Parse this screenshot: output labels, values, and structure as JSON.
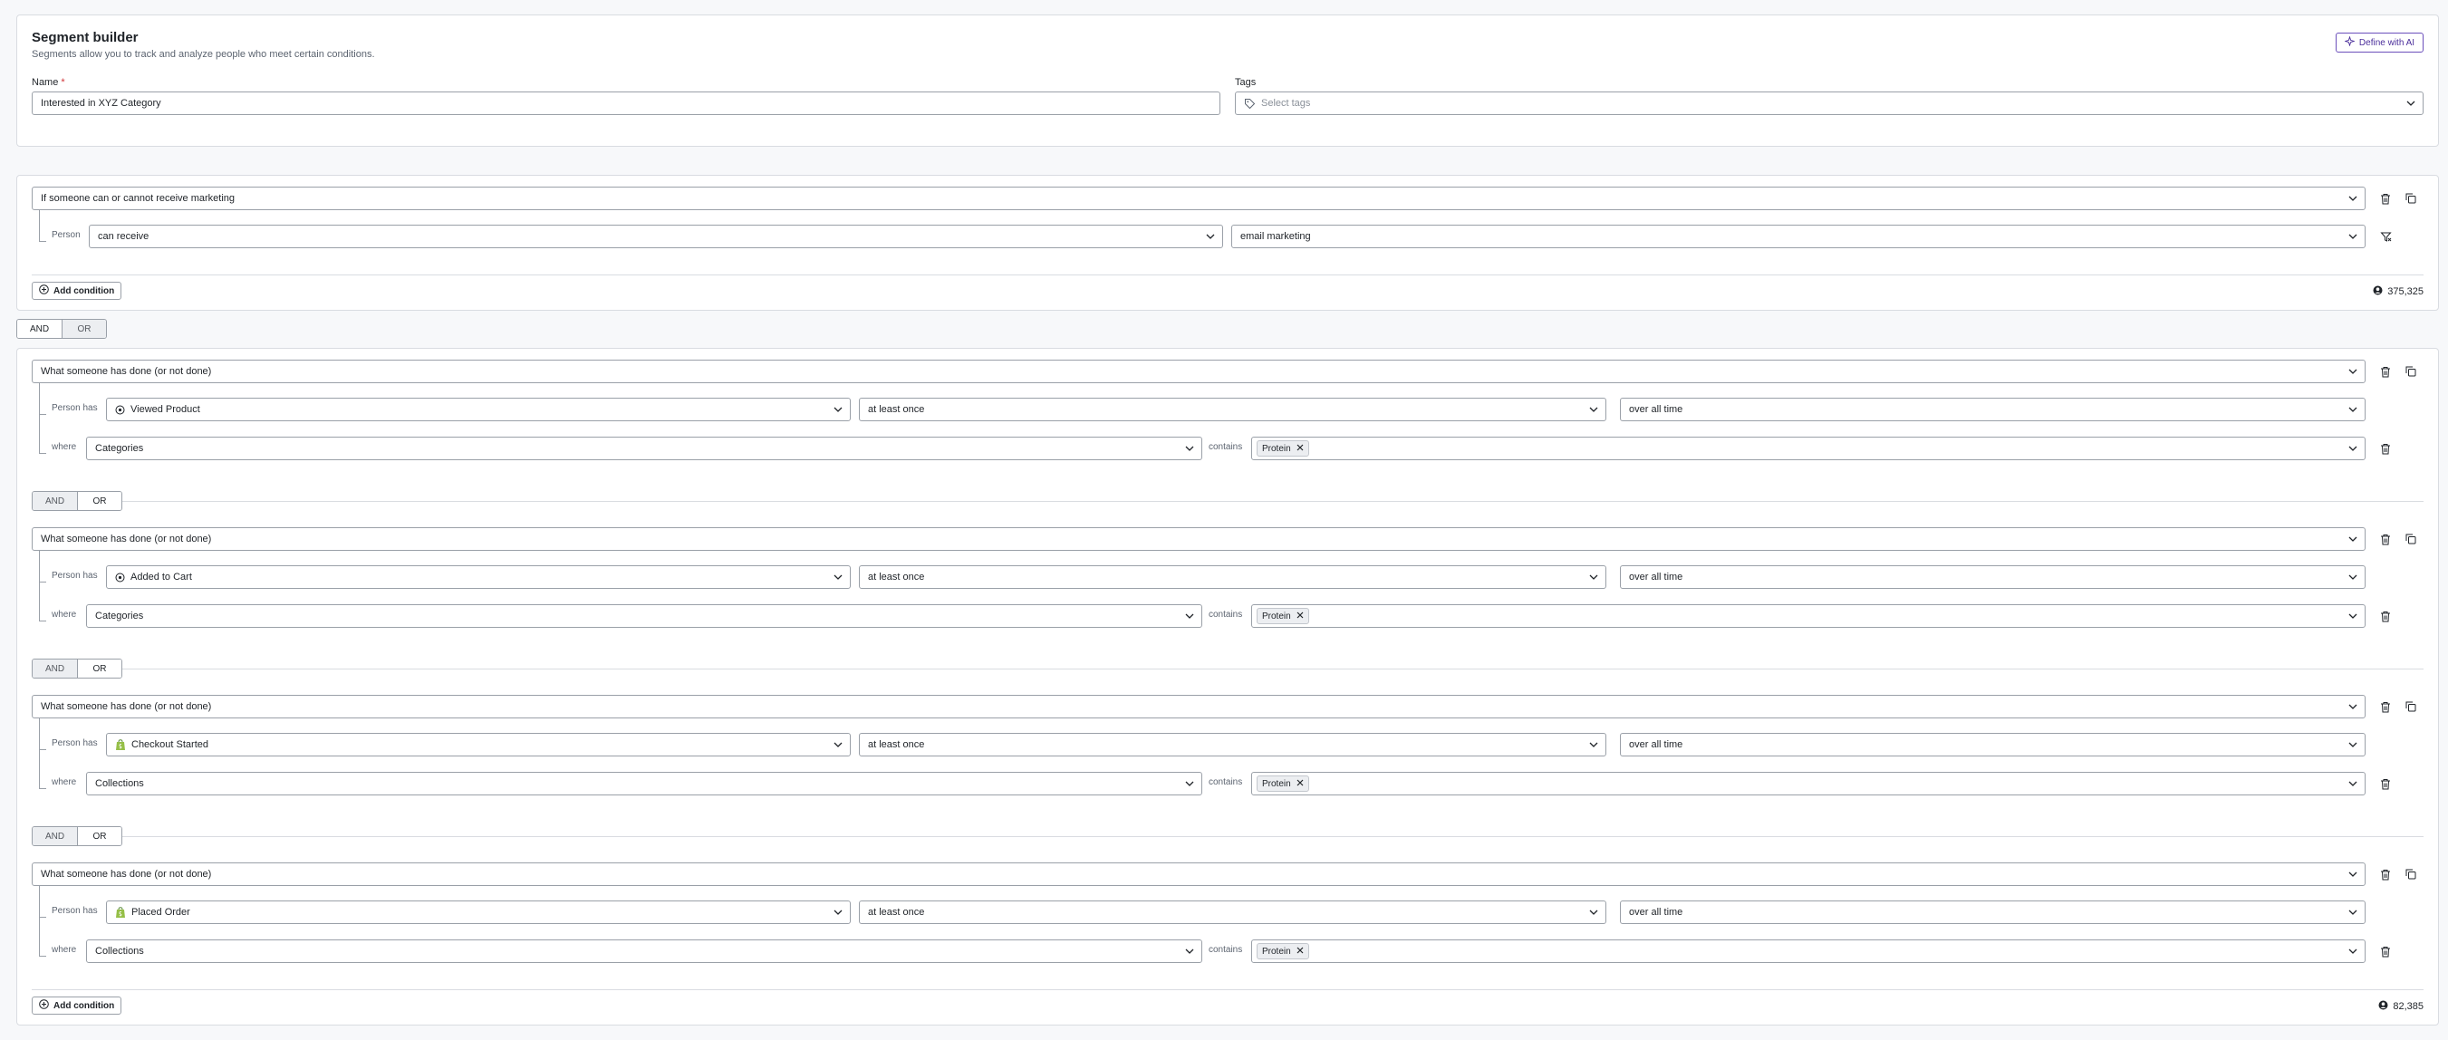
{
  "header": {
    "title": "Segment builder",
    "subtitle": "Segments allow you to track and analyze people who meet certain conditions.",
    "define_ai_label": "Define with AI",
    "name_label": "Name",
    "required_mark": "*",
    "name_value": "Interested in XYZ Category",
    "tags_label": "Tags",
    "tags_placeholder": "Select tags"
  },
  "group1": {
    "condition_type": "If someone can or cannot receive marketing",
    "person_label": "Person",
    "receive_value": "can receive",
    "channel_value": "email marketing",
    "add_condition_label": "Add condition",
    "count": "375,325"
  },
  "join": {
    "and": "AND",
    "or": "OR"
  },
  "group2": {
    "blocks": [
      {
        "condition_type": "What someone has done (or not done)",
        "person_has_label": "Person has",
        "event": "Viewed Product",
        "event_icon": "target-icon",
        "frequency": "at least once",
        "timeframe": "over all time",
        "where_label": "where",
        "property": "Categories",
        "operator": "contains",
        "tag": "Protein"
      },
      {
        "condition_type": "What someone has done (or not done)",
        "person_has_label": "Person has",
        "event": "Added to Cart",
        "event_icon": "target-icon",
        "frequency": "at least once",
        "timeframe": "over all time",
        "where_label": "where",
        "property": "Categories",
        "operator": "contains",
        "tag": "Protein"
      },
      {
        "condition_type": "What someone has done (or not done)",
        "person_has_label": "Person has",
        "event": "Checkout Started",
        "event_icon": "shopify-icon",
        "frequency": "at least once",
        "timeframe": "over all time",
        "where_label": "where",
        "property": "Collections",
        "operator": "contains",
        "tag": "Protein"
      },
      {
        "condition_type": "What someone has done (or not done)",
        "person_has_label": "Person has",
        "event": "Placed Order",
        "event_icon": "shopify-icon",
        "frequency": "at least once",
        "timeframe": "over all time",
        "where_label": "where",
        "property": "Collections",
        "operator": "contains",
        "tag": "Protein"
      }
    ],
    "add_condition_label": "Add condition",
    "count": "82,385"
  },
  "colors": {
    "accent": "#6b4fbb",
    "border": "#9aa0a8",
    "shopify": "#95bf47"
  }
}
